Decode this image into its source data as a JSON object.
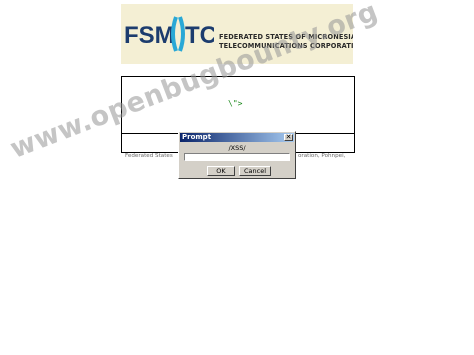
{
  "logo": {
    "abbr_left": "FSM",
    "abbr_right": "TC",
    "line1": "FEDERATED STATES OF MICRONESIA",
    "line2": "TELECOMMUNICATIONS CORPORATION",
    "colors": {
      "text": "#1c3c6e",
      "accent": "#29a8d6",
      "background": "#f4efd4"
    }
  },
  "content": {
    "payload": "\\\">",
    "footer_left": "Federated States",
    "footer_right": "oration, Pohnpei,"
  },
  "dialog": {
    "title": "Prompt",
    "close_glyph": "✕",
    "message": "/XSS/",
    "input_value": "",
    "ok_label": "OK",
    "cancel_label": "Cancel"
  },
  "watermark": {
    "text": "www.openbugbounty.org"
  }
}
